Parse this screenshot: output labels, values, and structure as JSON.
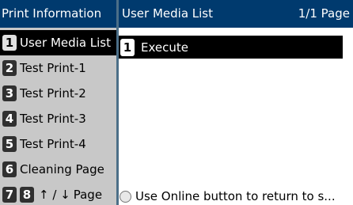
{
  "left_panel": {
    "title": "Print Information",
    "items": [
      {
        "number": "1",
        "label": "User Media List"
      },
      {
        "number": "2",
        "label": "Test Print-1"
      },
      {
        "number": "3",
        "label": "Test Print-2"
      },
      {
        "number": "4",
        "label": "Test Print-3"
      },
      {
        "number": "5",
        "label": "Test Print-4"
      },
      {
        "number": "6",
        "label": "Cleaning Page"
      }
    ],
    "bottom": {
      "number_a": "7",
      "number_b": "8",
      "arrows": "↑ / ↓",
      "label": "Page"
    }
  },
  "right_panel": {
    "title": "User Media List",
    "page_indicator": "1/1 Page",
    "menu": [
      {
        "number": "1",
        "label": "Execute"
      }
    ],
    "footer": {
      "icon": "online-button-icon",
      "text": "Use Online button to return to s..."
    }
  },
  "colors": {
    "header_bg": "#003a6e",
    "selected_bg": "#000000",
    "panel_bg": "#c8c8c8"
  }
}
